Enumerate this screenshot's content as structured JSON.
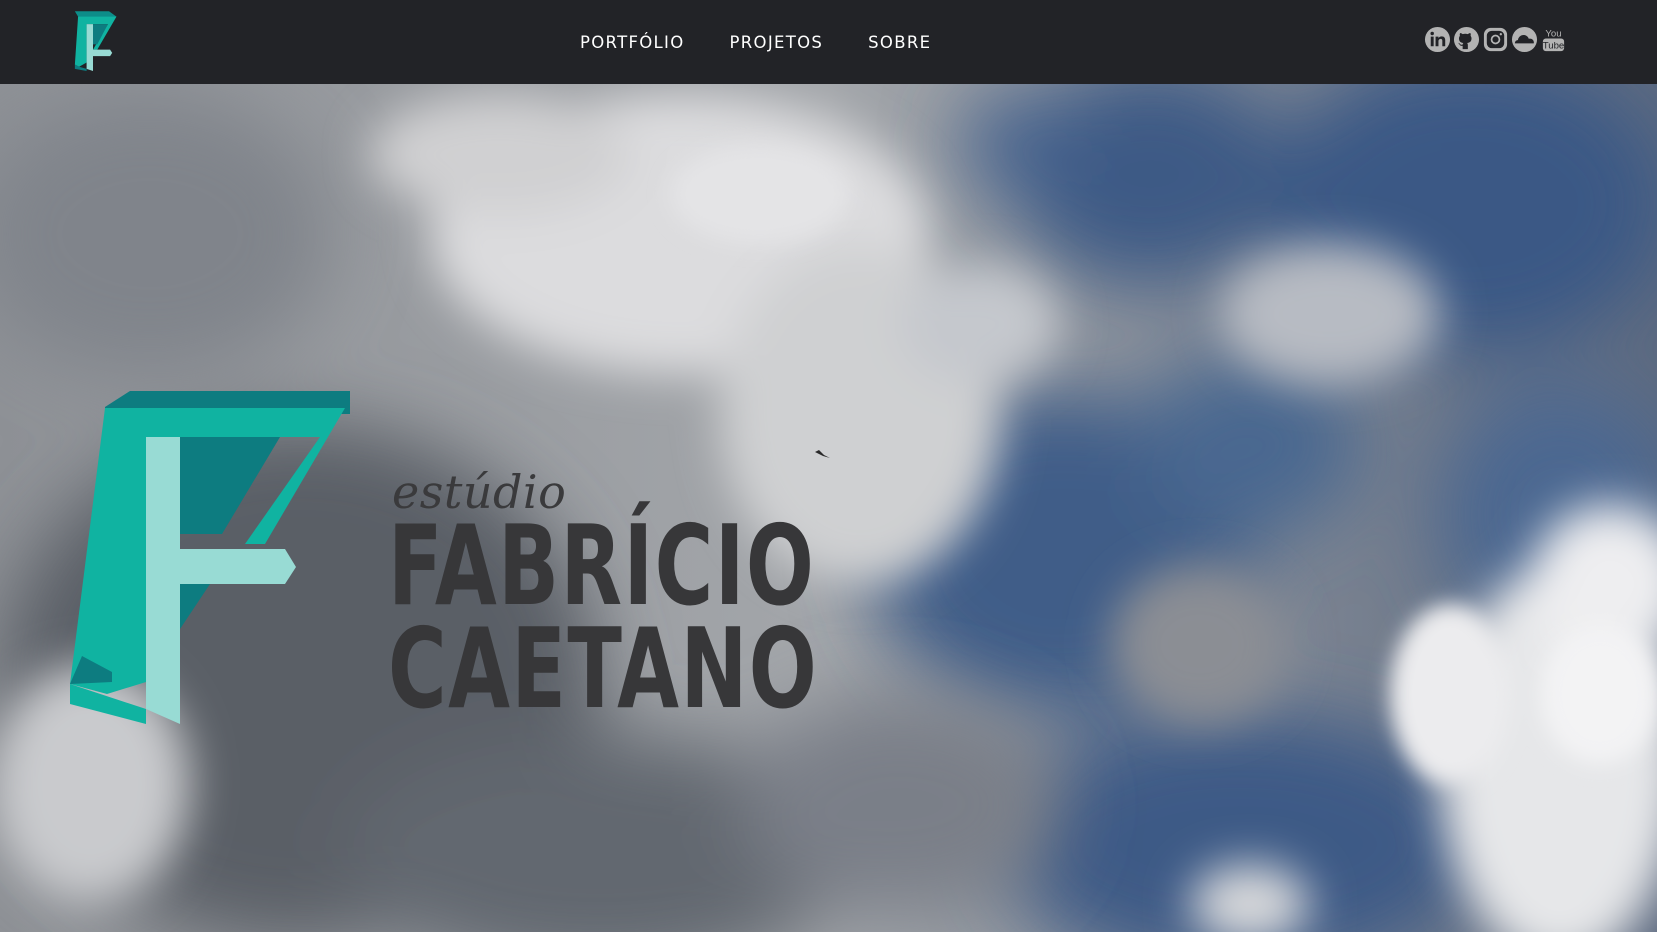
{
  "header": {
    "logo_icon": "fc-monogram-logo",
    "nav": [
      {
        "label": "PORTFÓLIO"
      },
      {
        "label": "PROJETOS"
      },
      {
        "label": "SOBRE"
      }
    ],
    "social": [
      {
        "icon": "linkedin-icon"
      },
      {
        "icon": "github-icon"
      },
      {
        "icon": "instagram-icon"
      },
      {
        "icon": "soundcloud-icon"
      },
      {
        "icon": "youtube-icon",
        "label_top": "You",
        "label_bottom": "Tube"
      }
    ]
  },
  "hero": {
    "script": "estúdio",
    "name_line1": "FABRÍCIO",
    "name_line2": "CAETANO",
    "background": "cloudy-sky-photo"
  },
  "colors": {
    "topbar": "#222327",
    "accent_teal": "#10b3a1",
    "accent_light": "#98dbd4",
    "accent_dark": "#0d7c80",
    "icon_gray": "#b3b3b3",
    "brand_text": "#373739"
  }
}
